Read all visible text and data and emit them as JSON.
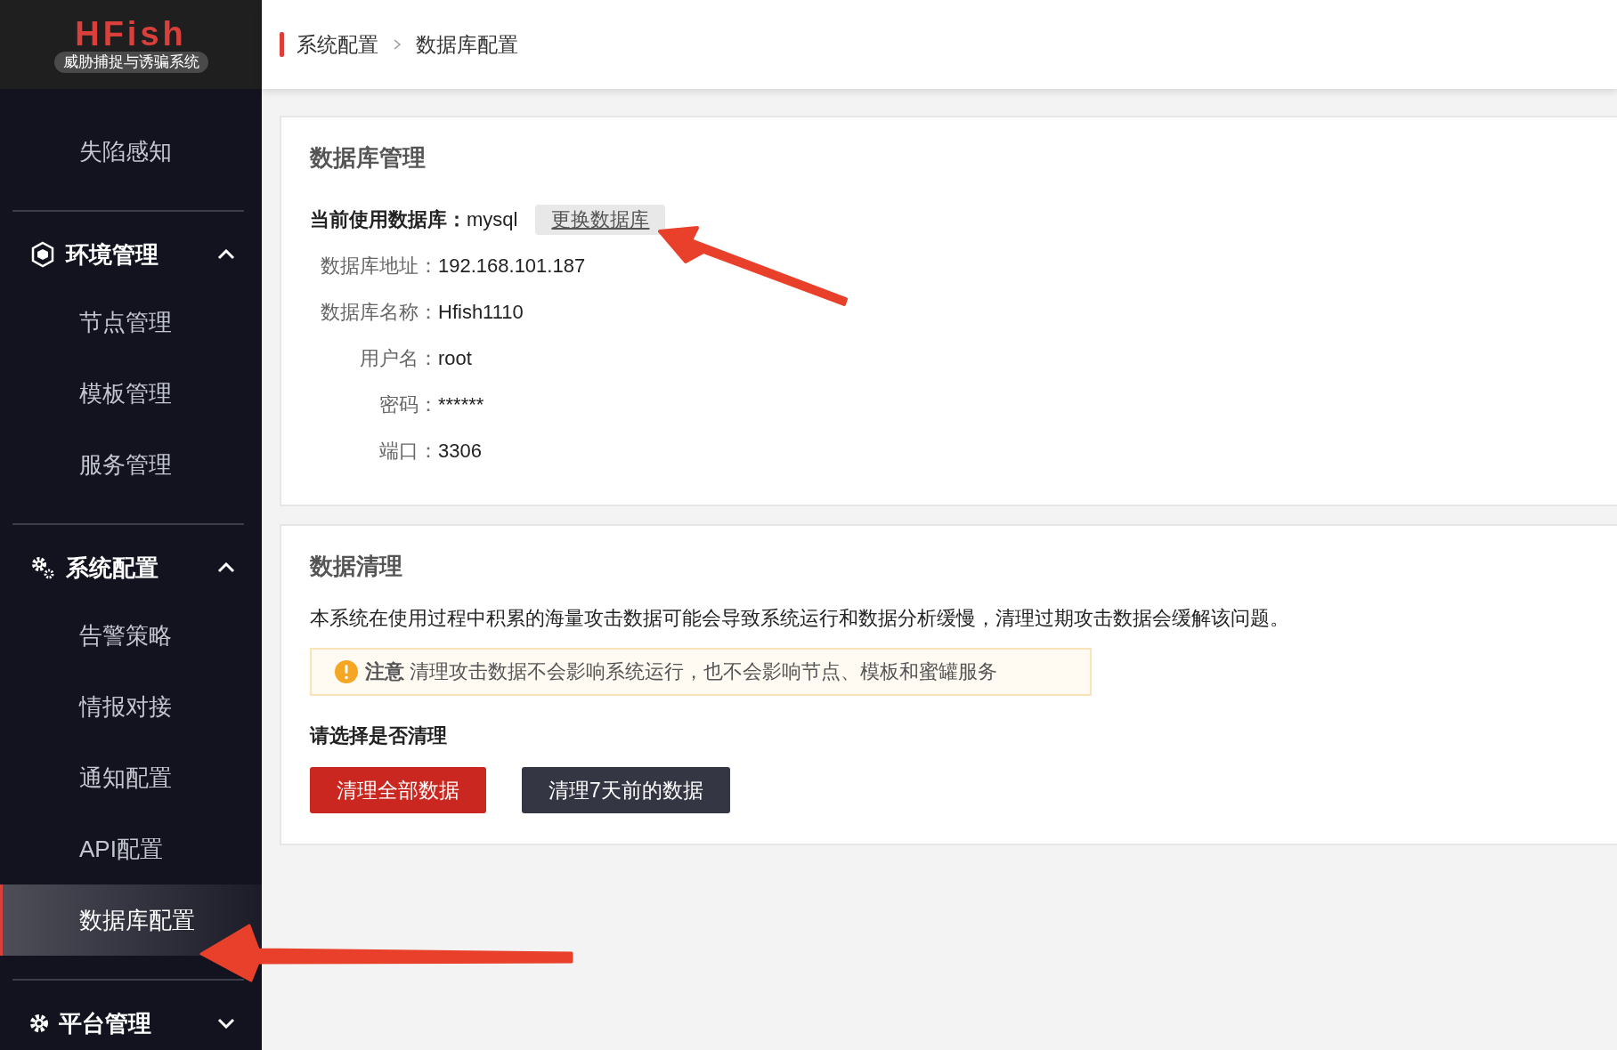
{
  "logo": {
    "title": "HFish",
    "subtitle": "威胁捕捉与诱骗系统"
  },
  "sidebar": {
    "items": [
      {
        "kind": "item",
        "label": "失陷感知",
        "selected": false
      },
      {
        "kind": "group",
        "label": "环境管理",
        "expanded": true,
        "children": [
          {
            "label": "节点管理",
            "selected": false
          },
          {
            "label": "模板管理",
            "selected": false
          },
          {
            "label": "服务管理",
            "selected": false
          }
        ]
      },
      {
        "kind": "group",
        "label": "系统配置",
        "expanded": true,
        "children": [
          {
            "label": "告警策略",
            "selected": false
          },
          {
            "label": "情报对接",
            "selected": false
          },
          {
            "label": "通知配置",
            "selected": false
          },
          {
            "label": "API配置",
            "selected": false
          },
          {
            "label": "数据库配置",
            "selected": true
          }
        ]
      },
      {
        "kind": "group",
        "label": "平台管理",
        "expanded": false
      }
    ]
  },
  "breadcrumb": [
    "系统配置",
    "数据库配置"
  ],
  "database": {
    "title": "数据库管理",
    "current": {
      "label": "当前使用数据库：",
      "value": "mysql",
      "button": "更换数据库"
    },
    "fields": [
      {
        "label": "数据库地址：",
        "value": "192.168.101.187"
      },
      {
        "label": "数据库名称：",
        "value": "Hfish1110"
      },
      {
        "label": "用户名：",
        "value": "root"
      },
      {
        "label": "密码：",
        "value": "******"
      },
      {
        "label": "端口：",
        "value": "3306"
      }
    ]
  },
  "cleanup": {
    "title": "数据清理",
    "description": "本系统在使用过程中积累的海量攻击数据可能会导致系统运行和数据分析缓慢，清理过期攻击数据会缓解该问题。",
    "notice": {
      "label": "注意",
      "text": "清理攻击数据不会影响系统运行，也不会影响节点、模板和蜜罐服务"
    },
    "prompt": "请选择是否清理",
    "buttons": [
      {
        "label": "清理全部数据",
        "kind": "danger"
      },
      {
        "label": "清理7天前的数据",
        "kind": "dark"
      }
    ]
  }
}
